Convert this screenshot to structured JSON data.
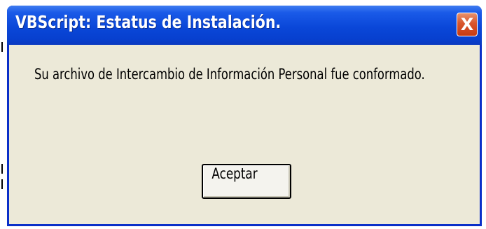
{
  "dialog": {
    "title": "VBScript: Estatus de Instalación.",
    "message": "Su archivo de Intercambio de Información Personal fue conformado.",
    "ok_label": "Aceptar",
    "close_glyph": "X"
  },
  "icons": {
    "close": "close-icon"
  },
  "colors": {
    "titlebar": "#0a47d8",
    "close_button": "#d8552d",
    "client_background": "#ece9d8"
  }
}
